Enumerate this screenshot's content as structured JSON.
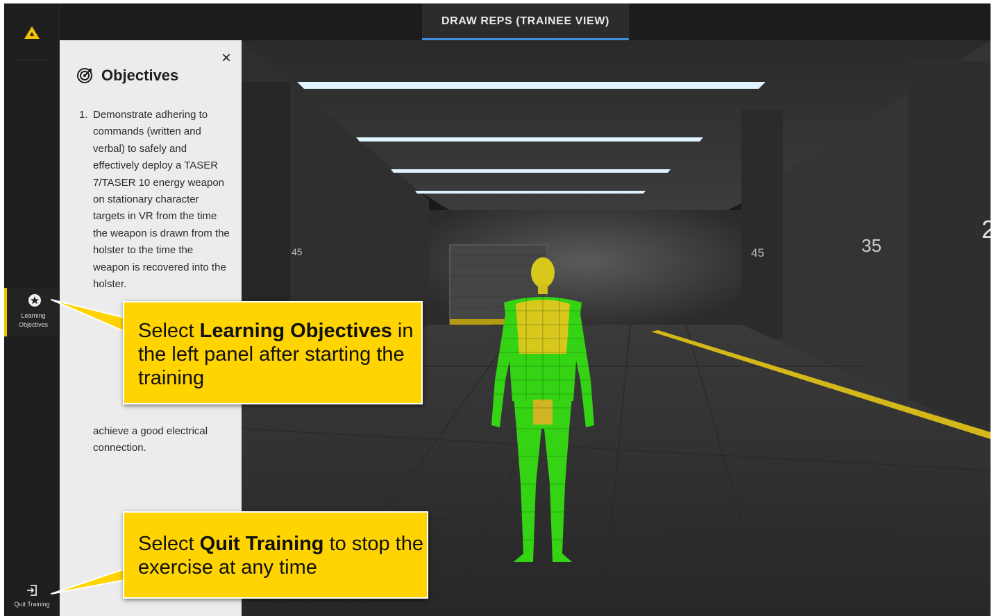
{
  "window": {
    "tab_title": "DRAW REPS (TRAINEE VIEW)"
  },
  "sidebar": {
    "logo": "axon-triangle-logo",
    "items": [
      {
        "label": "Learning Objectives",
        "icon": "star-circle-icon",
        "active": true
      },
      {
        "label": "Quit Training",
        "icon": "exit-icon"
      }
    ]
  },
  "objectives_panel": {
    "title": "Objectives",
    "title_icon": "target-icon",
    "close_label": "×",
    "items": [
      {
        "number": "1.",
        "text": "Demonstrate adhering to commands (written and verbal) to safely and effectively deploy a TASER 7/TASER 10 energy weapon on stationary character targets in VR from the time the weapon is drawn from the holster to the time the weapon is recovered into the holster."
      },
      {
        "number": "",
        "text": "achieve a good electrical connection."
      }
    ]
  },
  "scene": {
    "distance_markers": [
      "45",
      "45",
      "35",
      "2"
    ]
  },
  "callouts": [
    {
      "pre": "Select ",
      "bold": "Learning Objectives",
      "post": " in the left panel after starting the training"
    },
    {
      "pre": "Select ",
      "bold": "Quit Training",
      "post": " to stop the exercise at any time"
    }
  ],
  "colors": {
    "accent_yellow": "#ffd400",
    "tab_underline": "#3d8fe0",
    "target_green": "#34d414",
    "target_yellow": "#d8c81c"
  }
}
